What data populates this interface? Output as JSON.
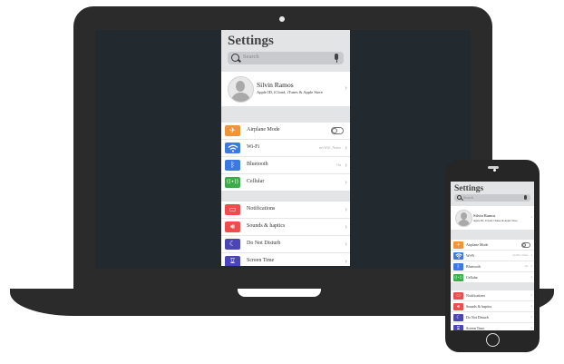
{
  "settings": {
    "title": "Settings",
    "search_placeholder": "Search",
    "profile": {
      "name": "Silvin Ramos",
      "subtitle": "Apple ID, iCloud, iTunes & Apple Store"
    },
    "group1": [
      {
        "label": "Airplane Mode",
        "icon": "airplane-icon",
        "color": "#f0943a",
        "control": "toggle"
      },
      {
        "label": "Wi-Fi",
        "icon": "wifi-icon",
        "color": "#3b7ae0",
        "value": "myWifi_Name"
      },
      {
        "label": "Bluetooth",
        "icon": "bluetooth-icon",
        "color": "#3b7ae0",
        "value": "On"
      },
      {
        "label": "Cellular",
        "icon": "cellular-icon",
        "color": "#3daa4a"
      }
    ],
    "group2": [
      {
        "label": "Notifications",
        "icon": "notifications-icon",
        "color": "#ef4d4d"
      },
      {
        "label": "Sounds & haptics",
        "icon": "sound-icon",
        "color": "#ef4d4d"
      },
      {
        "label": "Do Not Disturb",
        "icon": "moon-icon",
        "color": "#4b45b5"
      },
      {
        "label": "Screen Time",
        "icon": "hourglass-icon",
        "color": "#4b45b5"
      }
    ]
  },
  "colors": {
    "device_body": "#2b2b2b",
    "laptop_screen": "#222a30",
    "app_background": "#e3e4e6"
  }
}
